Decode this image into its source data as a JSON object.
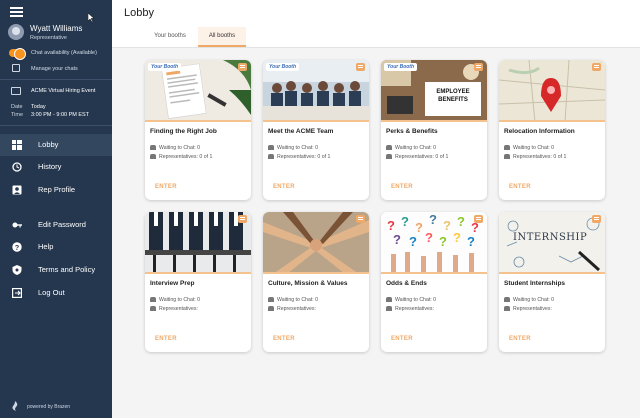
{
  "sidebar": {
    "user": {
      "name": "Wyatt Williams",
      "role": "Representative"
    },
    "chat_availability": "Chat availability (Available)",
    "manage_chats": "Manage your chats",
    "event": {
      "title": "ACME Virtual Hiring Event",
      "date_key": "Date",
      "date_value": "Today",
      "time_key": "Time",
      "time_value": "3:00 PM - 9:00 PM EST"
    },
    "nav": [
      {
        "label": "Lobby",
        "icon": "dashboard-icon"
      },
      {
        "label": "History",
        "icon": "history-icon"
      },
      {
        "label": "Rep Profile",
        "icon": "profile-icon"
      },
      {
        "label": "Edit Password",
        "icon": "key-icon"
      },
      {
        "label": "Help",
        "icon": "help-icon"
      },
      {
        "label": "Terms and Policy",
        "icon": "shield-icon"
      },
      {
        "label": "Log Out",
        "icon": "logout-icon"
      }
    ],
    "powered_by": "powered by Brazen"
  },
  "header": {
    "title": "Lobby",
    "tabs": [
      {
        "label": "Your booths"
      },
      {
        "label": "All booths"
      }
    ]
  },
  "booths": [
    {
      "title": "Finding the Right Job",
      "badge": "Your Booth",
      "waiting": "Waiting to Chat: 0",
      "reps": "Representatives: 0 of 1",
      "enter": "ENTER"
    },
    {
      "title": "Meet the ACME Team",
      "badge": "Your Booth",
      "waiting": "Waiting to Chat: 0",
      "reps": "Representatives: 0 of 1",
      "enter": "ENTER"
    },
    {
      "title": "Perks & Benefits",
      "badge": "Your Booth",
      "waiting": "Waiting to Chat: 0",
      "reps": "Representatives: 0 of 1",
      "enter": "ENTER",
      "image_text": "EMPLOYEE BENEFITS"
    },
    {
      "title": "Relocation Information",
      "badge": "",
      "waiting": "Waiting to Chat: 0",
      "reps": "Representatives: 0 of 1",
      "enter": "ENTER"
    },
    {
      "title": "Interview Prep",
      "badge": "",
      "waiting": "Waiting to Chat: 0",
      "reps": "Representatives:",
      "enter": "ENTER"
    },
    {
      "title": "Culture, Mission & Values",
      "badge": "",
      "waiting": "Waiting to Chat: 0",
      "reps": "Representatives:",
      "enter": "ENTER"
    },
    {
      "title": "Odds & Ends",
      "badge": "",
      "waiting": "Waiting to Chat: 0",
      "reps": "Representatives:",
      "enter": "ENTER"
    },
    {
      "title": "Student Internships",
      "badge": "",
      "waiting": "Waiting to Chat: 0",
      "reps": "Representatives:",
      "enter": "ENTER",
      "image_text": "INTERNSHIP"
    }
  ],
  "colors": {
    "sidebar_bg": "#25374f",
    "accent": "#f0a866",
    "toggle": "#f7931e"
  }
}
